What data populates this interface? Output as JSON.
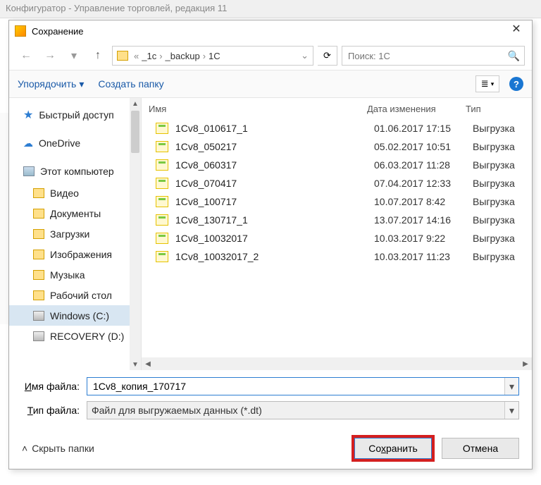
{
  "parent_window_title": "Конфигуратор - Управление торговлей, редакция 11",
  "dialog": {
    "title": "Сохранение",
    "breadcrumbs": [
      "_1c",
      "_backup",
      "1C"
    ],
    "search_placeholder": "Поиск: 1C",
    "toolbar": {
      "organize": "Упорядочить",
      "new_folder": "Создать папку"
    },
    "columns": {
      "name": "Имя",
      "date": "Дата изменения",
      "type": "Тип"
    },
    "tree": {
      "quick": "Быстрый доступ",
      "onedrive": "OneDrive",
      "this_pc": "Этот компьютер",
      "videos": "Видео",
      "documents": "Документы",
      "downloads": "Загрузки",
      "pictures": "Изображения",
      "music": "Музыка",
      "desktop": "Рабочий стол",
      "disk_c": "Windows (C:)",
      "disk_d": "RECOVERY (D:)"
    },
    "files": [
      {
        "name": "1Cv8_010617_1",
        "date": "01.06.2017 17:15",
        "type": "Выгрузка"
      },
      {
        "name": "1Cv8_050217",
        "date": "05.02.2017 10:51",
        "type": "Выгрузка"
      },
      {
        "name": "1Cv8_060317",
        "date": "06.03.2017 11:28",
        "type": "Выгрузка"
      },
      {
        "name": "1Cv8_070417",
        "date": "07.04.2017 12:33",
        "type": "Выгрузка"
      },
      {
        "name": "1Cv8_100717",
        "date": "10.07.2017 8:42",
        "type": "Выгрузка"
      },
      {
        "name": "1Cv8_130717_1",
        "date": "13.07.2017 14:16",
        "type": "Выгрузка"
      },
      {
        "name": "1Cv8_10032017",
        "date": "10.03.2017 9:22",
        "type": "Выгрузка"
      },
      {
        "name": "1Cv8_10032017_2",
        "date": "10.03.2017 11:23",
        "type": "Выгрузка"
      }
    ],
    "filename_label": "Имя файла:",
    "filename_value": "1Cv8_копия_170717",
    "filetype_label": "Тип файла:",
    "filetype_value": "Файл для выгружаемых данных (*.dt)",
    "hide_folders": "Скрыть папки",
    "save_btn": "Сохранить",
    "cancel_btn": "Отмена"
  }
}
